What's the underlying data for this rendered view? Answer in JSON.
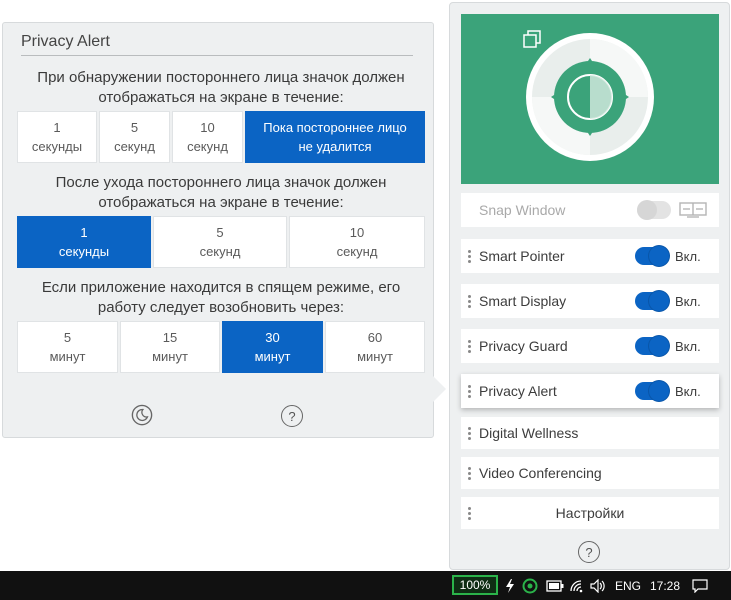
{
  "privacy_alert": {
    "title": "Privacy Alert",
    "q1": "При обнаружении постороннего лица значок должен отображаться на экране в течение:",
    "q1_options": [
      {
        "line1": "1",
        "line2": "секунды",
        "selected": false
      },
      {
        "line1": "5",
        "line2": "секунд",
        "selected": false
      },
      {
        "line1": "10",
        "line2": "секунд",
        "selected": false
      },
      {
        "line1": "Пока постороннее лицо",
        "line2": "не удалится",
        "selected": true
      }
    ],
    "q2": "После ухода постороннего лица значок должен отображаться на экране в течение:",
    "q2_options": [
      {
        "line1": "1",
        "line2": "секунды",
        "selected": true
      },
      {
        "line1": "5",
        "line2": "секунд",
        "selected": false
      },
      {
        "line1": "10",
        "line2": "секунд",
        "selected": false
      }
    ],
    "q3": "Если приложение находится в спящем режиме, его работу следует возобновить через:",
    "q3_options": [
      {
        "line1": "5",
        "line2": "минут",
        "selected": false
      },
      {
        "line1": "15",
        "line2": "минут",
        "selected": false
      },
      {
        "line1": "30",
        "line2": "минут",
        "selected": true
      },
      {
        "line1": "60",
        "line2": "минут",
        "selected": false
      }
    ],
    "sleep_icon": "moon-icon",
    "help_glyph": "?"
  },
  "sidebar": {
    "hero_color": "#3ba37a",
    "items": [
      {
        "label": "Snap Window",
        "toggle": "off",
        "state": "",
        "disabled": true
      },
      {
        "label": "Smart Pointer",
        "toggle": "on",
        "state": "Вкл."
      },
      {
        "label": "Smart Display",
        "toggle": "on",
        "state": "Вкл."
      },
      {
        "label": "Privacy Guard",
        "toggle": "on",
        "state": "Вкл."
      },
      {
        "label": "Privacy Alert",
        "toggle": "on",
        "state": "Вкл.",
        "active": true
      },
      {
        "label": "Digital Wellness"
      },
      {
        "label": "Video Conferencing"
      },
      {
        "label": "Настройки"
      }
    ],
    "help_glyph": "?"
  },
  "taskbar": {
    "battery": "100%",
    "language": "ENG",
    "time": "17:28"
  },
  "colors": {
    "accent": "#0b64c4",
    "hero": "#3ba37a",
    "battery_border": "#2bb34a"
  }
}
